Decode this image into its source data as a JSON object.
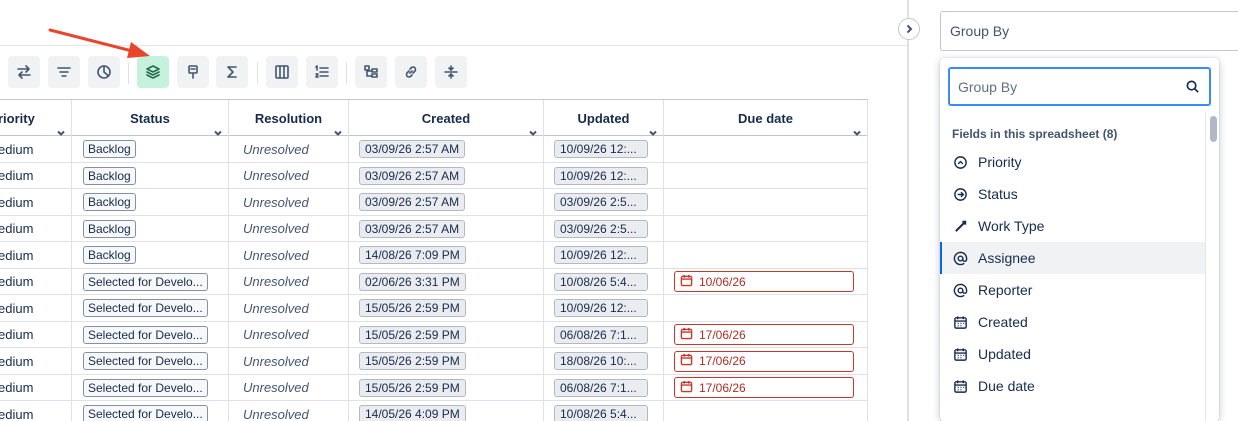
{
  "toolbar": {
    "buttons": [
      "swap-icon",
      "filter-icon",
      "pie-chart-icon",
      "layers-icon",
      "paint-format-icon",
      "sum-icon",
      "columns-icon",
      "numbered-list-icon",
      "hierarchy-icon",
      "link-icon",
      "collapse-rows-icon"
    ],
    "active": "layers-icon"
  },
  "table": {
    "headers": {
      "priority": "riority",
      "status": "Status",
      "resolution": "Resolution",
      "created": "Created",
      "updated": "Updated",
      "due": "Due date"
    },
    "rows": [
      {
        "priority": "edium",
        "status": "Backlog",
        "resolution": "Unresolved",
        "created": "03/09/26 2:57 AM",
        "updated": "10/09/26 12:...",
        "due": ""
      },
      {
        "priority": "edium",
        "status": "Backlog",
        "resolution": "Unresolved",
        "created": "03/09/26 2:57 AM",
        "updated": "10/09/26 12:...",
        "due": ""
      },
      {
        "priority": "edium",
        "status": "Backlog",
        "resolution": "Unresolved",
        "created": "03/09/26 2:57 AM",
        "updated": "03/09/26 2:5...",
        "due": ""
      },
      {
        "priority": "edium",
        "status": "Backlog",
        "resolution": "Unresolved",
        "created": "03/09/26 2:57 AM",
        "updated": "03/09/26 2:5...",
        "due": ""
      },
      {
        "priority": "edium",
        "status": "Backlog",
        "resolution": "Unresolved",
        "created": "14/08/26 7:09 PM",
        "updated": "10/09/26 12:...",
        "due": ""
      },
      {
        "priority": "edium",
        "status": "Selected for Develo...",
        "resolution": "Unresolved",
        "created": "02/06/26 3:31 PM",
        "updated": "10/08/26 5:4...",
        "due": "10/06/26"
      },
      {
        "priority": "edium",
        "status": "Selected for Develo...",
        "resolution": "Unresolved",
        "created": "15/05/26 2:59 PM",
        "updated": "10/09/26 12:...",
        "due": ""
      },
      {
        "priority": "edium",
        "status": "Selected for Develo...",
        "resolution": "Unresolved",
        "created": "15/05/26 2:59 PM",
        "updated": "06/08/26 7:1...",
        "due": "17/06/26"
      },
      {
        "priority": "edium",
        "status": "Selected for Develo...",
        "resolution": "Unresolved",
        "created": "15/05/26 2:59 PM",
        "updated": "18/08/26 10:...",
        "due": "17/06/26"
      },
      {
        "priority": "edium",
        "status": "Selected for Develo...",
        "resolution": "Unresolved",
        "created": "15/05/26 2:59 PM",
        "updated": "06/08/26 7:1...",
        "due": "17/06/26"
      },
      {
        "priority": "edium",
        "status": "Selected for Develo...",
        "resolution": "Unresolved",
        "created": "14/05/26 4:09 PM",
        "updated": "10/08/26 5:4...",
        "due": ""
      }
    ]
  },
  "panel": {
    "groupby_label": "Group By",
    "search_placeholder": "Group By",
    "section_title": "Fields in this spreadsheet (8)",
    "fields": [
      {
        "label": "Priority",
        "icon": "priority-icon"
      },
      {
        "label": "Status",
        "icon": "status-icon"
      },
      {
        "label": "Work Type",
        "icon": "work-type-icon"
      },
      {
        "label": "Assignee",
        "icon": "at-icon",
        "selected": true
      },
      {
        "label": "Reporter",
        "icon": "at-icon"
      },
      {
        "label": "Created",
        "icon": "calendar-icon"
      },
      {
        "label": "Updated",
        "icon": "calendar-icon"
      },
      {
        "label": "Due date",
        "icon": "calendar-icon"
      }
    ]
  },
  "colors": {
    "active_button": "#c6f1dc",
    "overdue": "#c9372c",
    "focus": "#388bff",
    "annotation_arrow": "#e8462a"
  }
}
